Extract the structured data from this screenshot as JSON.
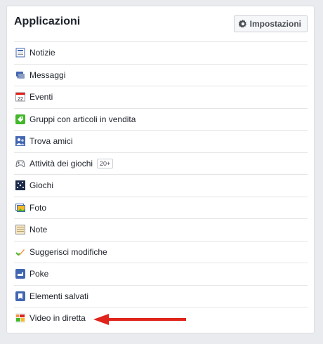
{
  "header": {
    "title": "Applicazioni",
    "settings_label": "Impostazioni"
  },
  "items": [
    {
      "label": "Notizie",
      "icon": "news-feed-icon"
    },
    {
      "label": "Messaggi",
      "icon": "messages-icon"
    },
    {
      "label": "Eventi",
      "icon": "calendar-icon",
      "icon_text": "22"
    },
    {
      "label": "Gruppi con articoli in vendita",
      "icon": "sale-tag-icon"
    },
    {
      "label": "Trova amici",
      "icon": "find-friends-icon"
    },
    {
      "label": "Attività dei giochi",
      "icon": "gamepad-icon",
      "badge": "20+"
    },
    {
      "label": "Giochi",
      "icon": "games-icon"
    },
    {
      "label": "Foto",
      "icon": "photo-icon"
    },
    {
      "label": "Note",
      "icon": "note-icon"
    },
    {
      "label": "Suggerisci modifiche",
      "icon": "checkmark-pencil-icon"
    },
    {
      "label": "Poke",
      "icon": "poke-icon"
    },
    {
      "label": "Elementi salvati",
      "icon": "bookmark-icon"
    },
    {
      "label": "Video in diretta",
      "icon": "live-video-icon"
    }
  ],
  "colors": {
    "accent": "#4267b2",
    "arrow": "#e0241b"
  }
}
